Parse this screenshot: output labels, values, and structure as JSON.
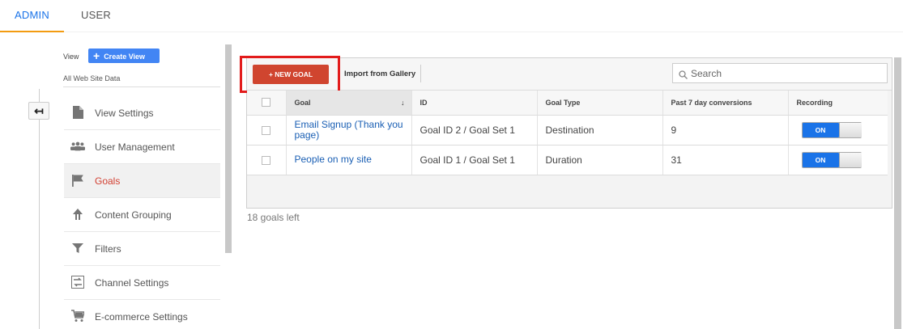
{
  "tabs": {
    "admin": "ADMIN",
    "user": "USER"
  },
  "view": {
    "label": "View",
    "create_view_label": "Create View",
    "current_view": "All Web Site Data"
  },
  "menu": {
    "items": [
      {
        "label": "View Settings",
        "icon": "document-icon"
      },
      {
        "label": "User Management",
        "icon": "users-icon"
      },
      {
        "label": "Goals",
        "icon": "flag-icon",
        "active": true
      },
      {
        "label": "Content Grouping",
        "icon": "content-grouping-icon"
      },
      {
        "label": "Filters",
        "icon": "filter-icon"
      },
      {
        "label": "Channel Settings",
        "icon": "channel-settings-icon"
      },
      {
        "label": "E-commerce Settings",
        "icon": "cart-icon"
      }
    ]
  },
  "toolbar": {
    "new_goal_label": "+ NEW GOAL",
    "import_label": "Import from Gallery",
    "search_placeholder": "Search"
  },
  "table": {
    "headers": {
      "goal": "Goal",
      "id": "ID",
      "type": "Goal Type",
      "conversions": "Past 7 day conversions",
      "recording": "Recording"
    },
    "rows": [
      {
        "goal": "Email Signup (Thank you page)",
        "id": "Goal ID 2 / Goal Set 1",
        "type": "Destination",
        "conversions": "9",
        "recording": "ON"
      },
      {
        "goal": "People on my site",
        "id": "Goal ID 1 / Goal Set 1",
        "type": "Duration",
        "conversions": "31",
        "recording": "ON"
      }
    ]
  },
  "goals_left": "18 goals left",
  "colors": {
    "accent_blue": "#1a73e8",
    "new_goal_red": "#d0452f",
    "highlight_red": "#e21b1b",
    "tab_underline": "#f39c12",
    "active_menu": "#d23f31"
  }
}
